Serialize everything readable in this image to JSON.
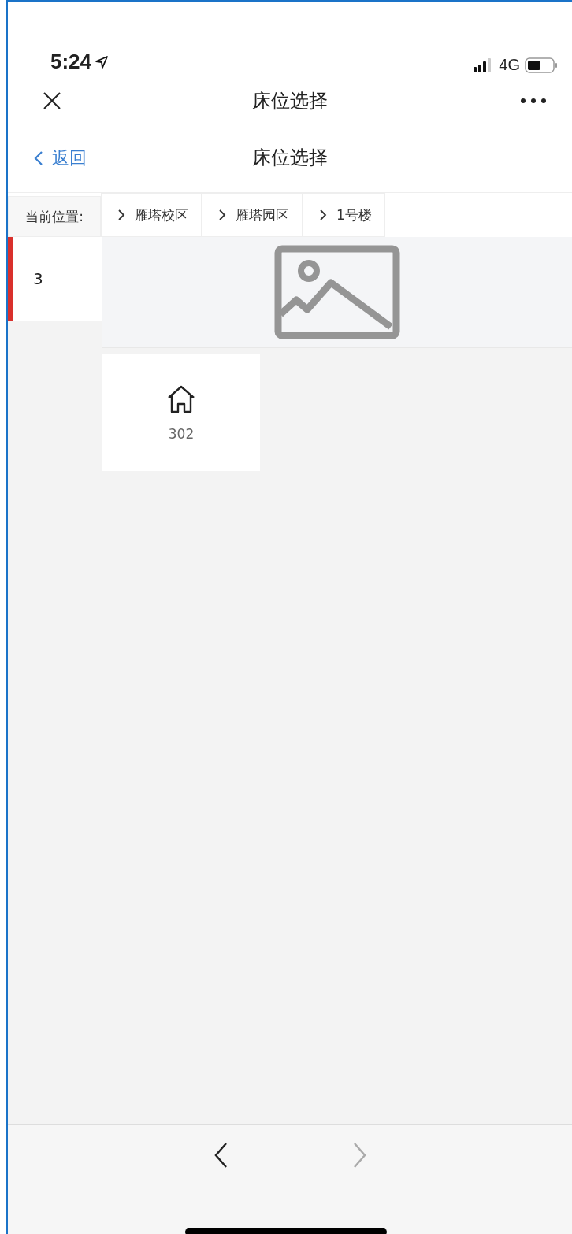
{
  "status_bar": {
    "time": "5:24",
    "network": "4G"
  },
  "nav_bar": {
    "title": "床位选择"
  },
  "header": {
    "back_label": "返回",
    "title": "床位选择"
  },
  "location_label": "当前位置:",
  "breadcrumbs": [
    {
      "label": "雁塔校区"
    },
    {
      "label": "雁塔园区"
    },
    {
      "label": "1号楼"
    }
  ],
  "floors": [
    {
      "label": "3",
      "selected": true
    }
  ],
  "rooms": [
    {
      "label": "302"
    }
  ],
  "toolbar": {
    "back_disabled": false,
    "forward_disabled": true
  }
}
